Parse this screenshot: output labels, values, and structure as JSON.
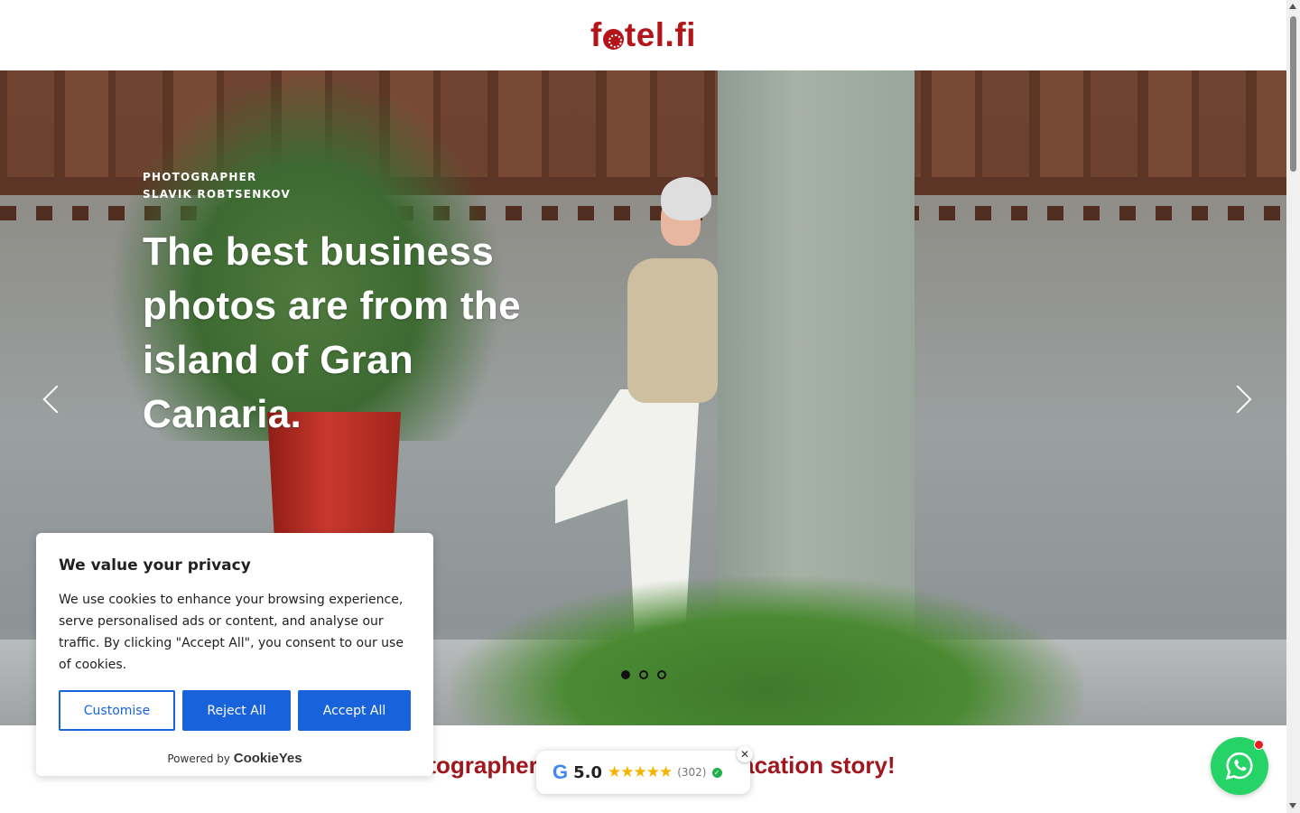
{
  "header": {
    "logo_pre": "f",
    "logo_post": "tel.fi"
  },
  "hero": {
    "eyebrow_line1": "PHOTOGRAPHER",
    "eyebrow_line2": "SLAVIK ROBTSENKOV",
    "title": "The best business photos are from the island of Gran Canaria.",
    "slides_total": 3,
    "active_slide": 1
  },
  "subtitle": "…tographer Slav… and your vacation story!",
  "cookie": {
    "title": "We value your privacy",
    "text": "We use cookies to enhance your browsing experience, serve personalised ads or content, and analyse our traffic. By clicking \"Accept All\", you consent to our use of cookies.",
    "customise": "Customise",
    "reject": "Reject All",
    "accept": "Accept All",
    "powered_by": "Powered by",
    "brand": "CookieYes"
  },
  "rating": {
    "google": "G",
    "score": "5.0",
    "stars": "★★★★★",
    "count": "(302)",
    "close": "✕"
  },
  "colors": {
    "brand": "#b3151b",
    "cookie_button": "#1863dc",
    "whatsapp": "#25d366"
  }
}
